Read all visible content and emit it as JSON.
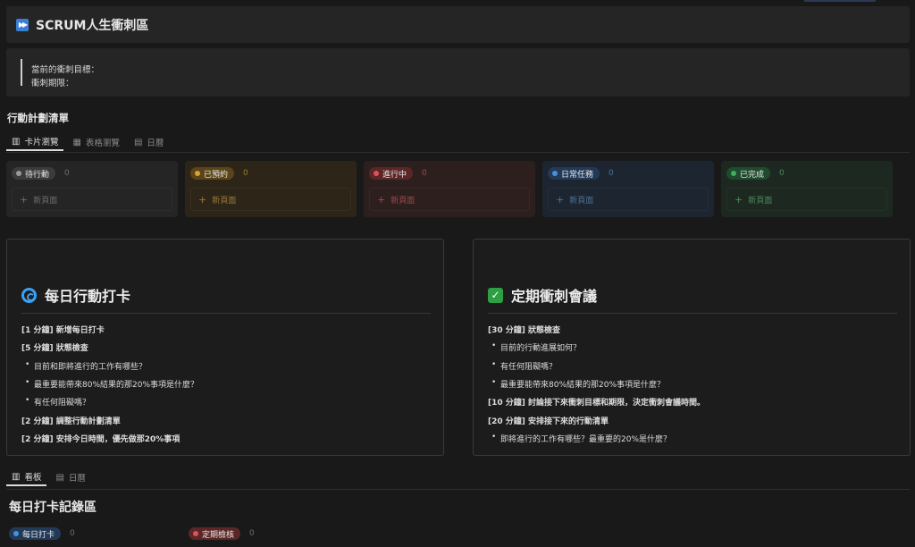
{
  "header": {
    "title": "SCRUM人生衝刺區",
    "icon": "fast-forward-icon"
  },
  "quote": {
    "line1": "當前的衝刺目標：",
    "line2": "衝刺期限："
  },
  "plan": {
    "title": "行動計劃清單",
    "tabs": [
      {
        "label": "卡片瀏覽",
        "icon": "board-icon"
      },
      {
        "label": "表格瀏覽",
        "icon": "table-icon"
      },
      {
        "label": "日曆",
        "icon": "calendar-icon"
      }
    ]
  },
  "columns": [
    {
      "label": "待行動",
      "count": "0",
      "new_label": "新頁面",
      "bg": "#252525",
      "pill_bg": "#3b3b3b",
      "dot": "#9b9b9b",
      "text": "#6e6e6e"
    },
    {
      "label": "已預約",
      "count": "0",
      "new_label": "新頁面",
      "bg": "#2d2618",
      "pill_bg": "#5a4418",
      "dot": "#d9a13a",
      "text": "#9a7a3a"
    },
    {
      "label": "進行中",
      "count": "0",
      "new_label": "新頁面",
      "bg": "#2e1f1f",
      "pill_bg": "#5c2626",
      "dot": "#e05252",
      "text": "#9a4a4a"
    },
    {
      "label": "日常任務",
      "count": "0",
      "new_label": "新頁面",
      "bg": "#1c2530",
      "pill_bg": "#223a57",
      "dot": "#4a90d9",
      "text": "#4c7398"
    },
    {
      "label": "已完成",
      "count": "0",
      "new_label": "新頁面",
      "bg": "#1d2820",
      "pill_bg": "#1f4a2e",
      "dot": "#3fae5e",
      "text": "#4c8a5e"
    }
  ],
  "daily_card": {
    "title": "每日行動打卡",
    "icon": "cyclone-icon",
    "lines": [
      {
        "text": "[1 分鐘] 新增每日打卡",
        "type": "heading"
      },
      {
        "text": "[5 分鐘] 狀態檢查",
        "type": "heading"
      },
      {
        "text": "目前和即將進行的工作有哪些？",
        "type": "bullet"
      },
      {
        "text": "最重要能帶來80%結果的那20%事項是什麼？",
        "type": "bullet"
      },
      {
        "text": "有任何阻礙嗎？",
        "type": "bullet"
      },
      {
        "text": "[2 分鐘] 調整行動計劃清單",
        "type": "heading"
      },
      {
        "text": "[2 分鐘] 安排今日時間，優先做那20%事項",
        "type": "heading"
      }
    ]
  },
  "meeting_card": {
    "title": "定期衝刺會議",
    "icon": "check-box-icon",
    "lines": [
      {
        "text": "[30 分鐘] 狀態檢查",
        "type": "heading"
      },
      {
        "text": "目前的行動進展如何？",
        "type": "bullet"
      },
      {
        "text": "有任何阻礙嗎？",
        "type": "bullet"
      },
      {
        "text": "最重要能帶來80%結果的那20%事項是什麼？",
        "type": "bullet"
      },
      {
        "text": "[10 分鐘] 討論接下來衝刺目標和期限，決定衝刺會議時間。",
        "type": "heading"
      },
      {
        "text": "[20 分鐘] 安排接下來的行動清單",
        "type": "heading"
      },
      {
        "text": "即將進行的工作有哪些？最重要的20%是什麼？",
        "type": "bullet"
      }
    ]
  },
  "log": {
    "tabs": [
      {
        "label": "看板",
        "icon": "board-icon"
      },
      {
        "label": "日曆",
        "icon": "calendar-icon"
      }
    ],
    "title": "每日打卡記錄區",
    "groups": [
      {
        "label": "每日打卡",
        "count": "0",
        "pill_bg": "#223a57",
        "dot": "#4a90d9"
      },
      {
        "label": "定期檢核",
        "count": "0",
        "pill_bg": "#5c2626",
        "dot": "#e05252"
      }
    ]
  }
}
